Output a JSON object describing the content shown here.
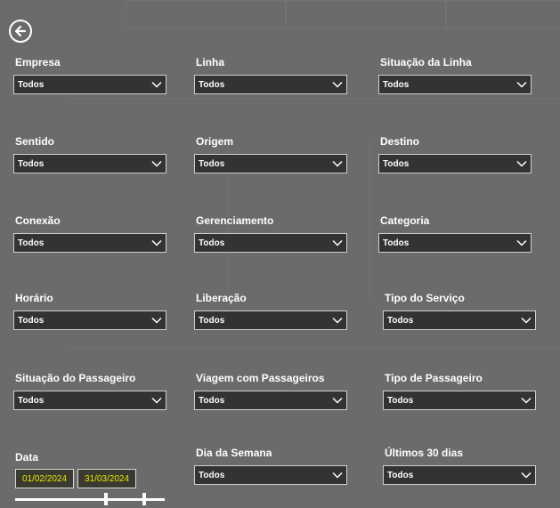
{
  "back_button": {
    "icon": "arrow-left-icon"
  },
  "filters": [
    {
      "label": "Empresa",
      "value": "Todos"
    },
    {
      "label": "Linha",
      "value": "Todos"
    },
    {
      "label": "Situação da Linha",
      "value": "Todos"
    },
    {
      "label": "Sentido",
      "value": "Todos"
    },
    {
      "label": "Origem",
      "value": "Todos"
    },
    {
      "label": "Destino",
      "value": "Todos"
    },
    {
      "label": "Conexão",
      "value": "Todos"
    },
    {
      "label": "Gerenciamento",
      "value": "Todos"
    },
    {
      "label": "Categoria",
      "value": "Todos"
    },
    {
      "label": "Horário",
      "value": "Todos"
    },
    {
      "label": "Liberação",
      "value": "Todos"
    },
    {
      "label": "Tipo do Serviço",
      "value": "Todos"
    },
    {
      "label": "Situação do Passageiro",
      "value": "Todos"
    },
    {
      "label": "Viagem com Passageiros",
      "value": "Todos"
    },
    {
      "label": "Tipo de Passageiro",
      "value": "Todos"
    },
    {
      "label": "Dia da Semana",
      "value": "Todos"
    },
    {
      "label": "Últimos 30 dias",
      "value": "Todos"
    }
  ],
  "date_filter": {
    "label": "Data",
    "start": "01/02/2024",
    "end": "31/03/2024"
  },
  "colors": {
    "overlay_background": "#6b6b6b",
    "dropdown_background": "#333333",
    "date_text": "#e8e600"
  }
}
